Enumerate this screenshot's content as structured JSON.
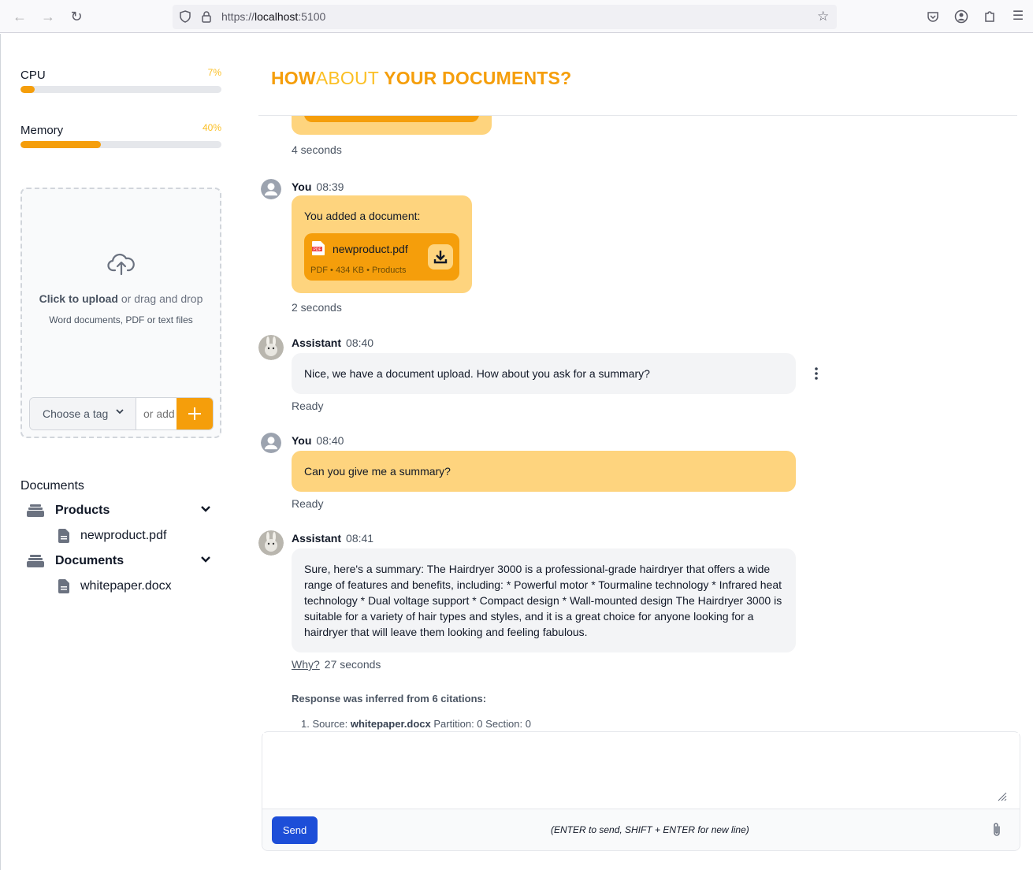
{
  "browser": {
    "url_prefix": "https://",
    "url_host": "localhost",
    "url_suffix": ":5100"
  },
  "sidebar": {
    "cpu": {
      "label": "CPU",
      "value_text": "7%",
      "fraction": 0.07
    },
    "memory": {
      "label": "Memory",
      "value_text": "40%",
      "fraction": 0.4
    },
    "upload": {
      "click_text": "Click to upload",
      "rest_text": " or drag and drop",
      "sub_text": "Word documents, PDF or text files",
      "tag_placeholder": "Choose a tag",
      "add_placeholder": "or add"
    },
    "documents_title": "Documents",
    "folders": [
      {
        "name": "Products",
        "files": [
          "newproduct.pdf"
        ]
      },
      {
        "name": "Documents",
        "files": [
          "whitepaper.docx"
        ]
      }
    ]
  },
  "header": {
    "title_part1": "HOW",
    "title_part2": "ABOUT",
    "title_part3": " YOUR DOCUMENTS?"
  },
  "chat": {
    "first_status": "4 seconds",
    "messages": [
      {
        "name": "You",
        "time": "08:39",
        "text": "You added a document:",
        "file": {
          "name": "newproduct.pdf",
          "type": "PDF",
          "size": "434 KB",
          "tag": "Products"
        },
        "status": "2 seconds"
      },
      {
        "name": "Assistant",
        "time": "08:40",
        "text": "Nice, we have a document upload. How about you ask for a summary?",
        "status": "Ready"
      },
      {
        "name": "You",
        "time": "08:40",
        "text": "Can you give me a summary?",
        "status": "Ready"
      },
      {
        "name": "Assistant",
        "time": "08:41",
        "text": "Sure, here's a summary: The Hairdryer 3000 is a professional-grade hairdryer that offers a wide range of features and benefits, including: * Powerful motor * Tourmaline technology * Infrared heat technology * Dual voltage support * Compact design * Wall-mounted design The Hairdryer 3000 is suitable for a variety of hair types and styles, and it is a great choice for anyone looking for a hairdryer that will leave them looking and feeling fabulous.",
        "why": "Why?",
        "status": "27 seconds"
      }
    ],
    "citations_title": "Response was inferred from 6 citations:",
    "citations": [
      {
        "num": "1. Source: ",
        "source": "whitepaper.docx",
        "partition": "Partition: 0",
        "section": "Section: 0"
      }
    ]
  },
  "composer": {
    "send_label": "Send",
    "hint": "(ENTER to send, SHIFT + ENTER for new line)"
  },
  "colors": {
    "accent": "#f59e0b",
    "user_bubble": "#fed47e",
    "bot_bubble": "#f3f4f6",
    "send": "#1d4ed8"
  }
}
